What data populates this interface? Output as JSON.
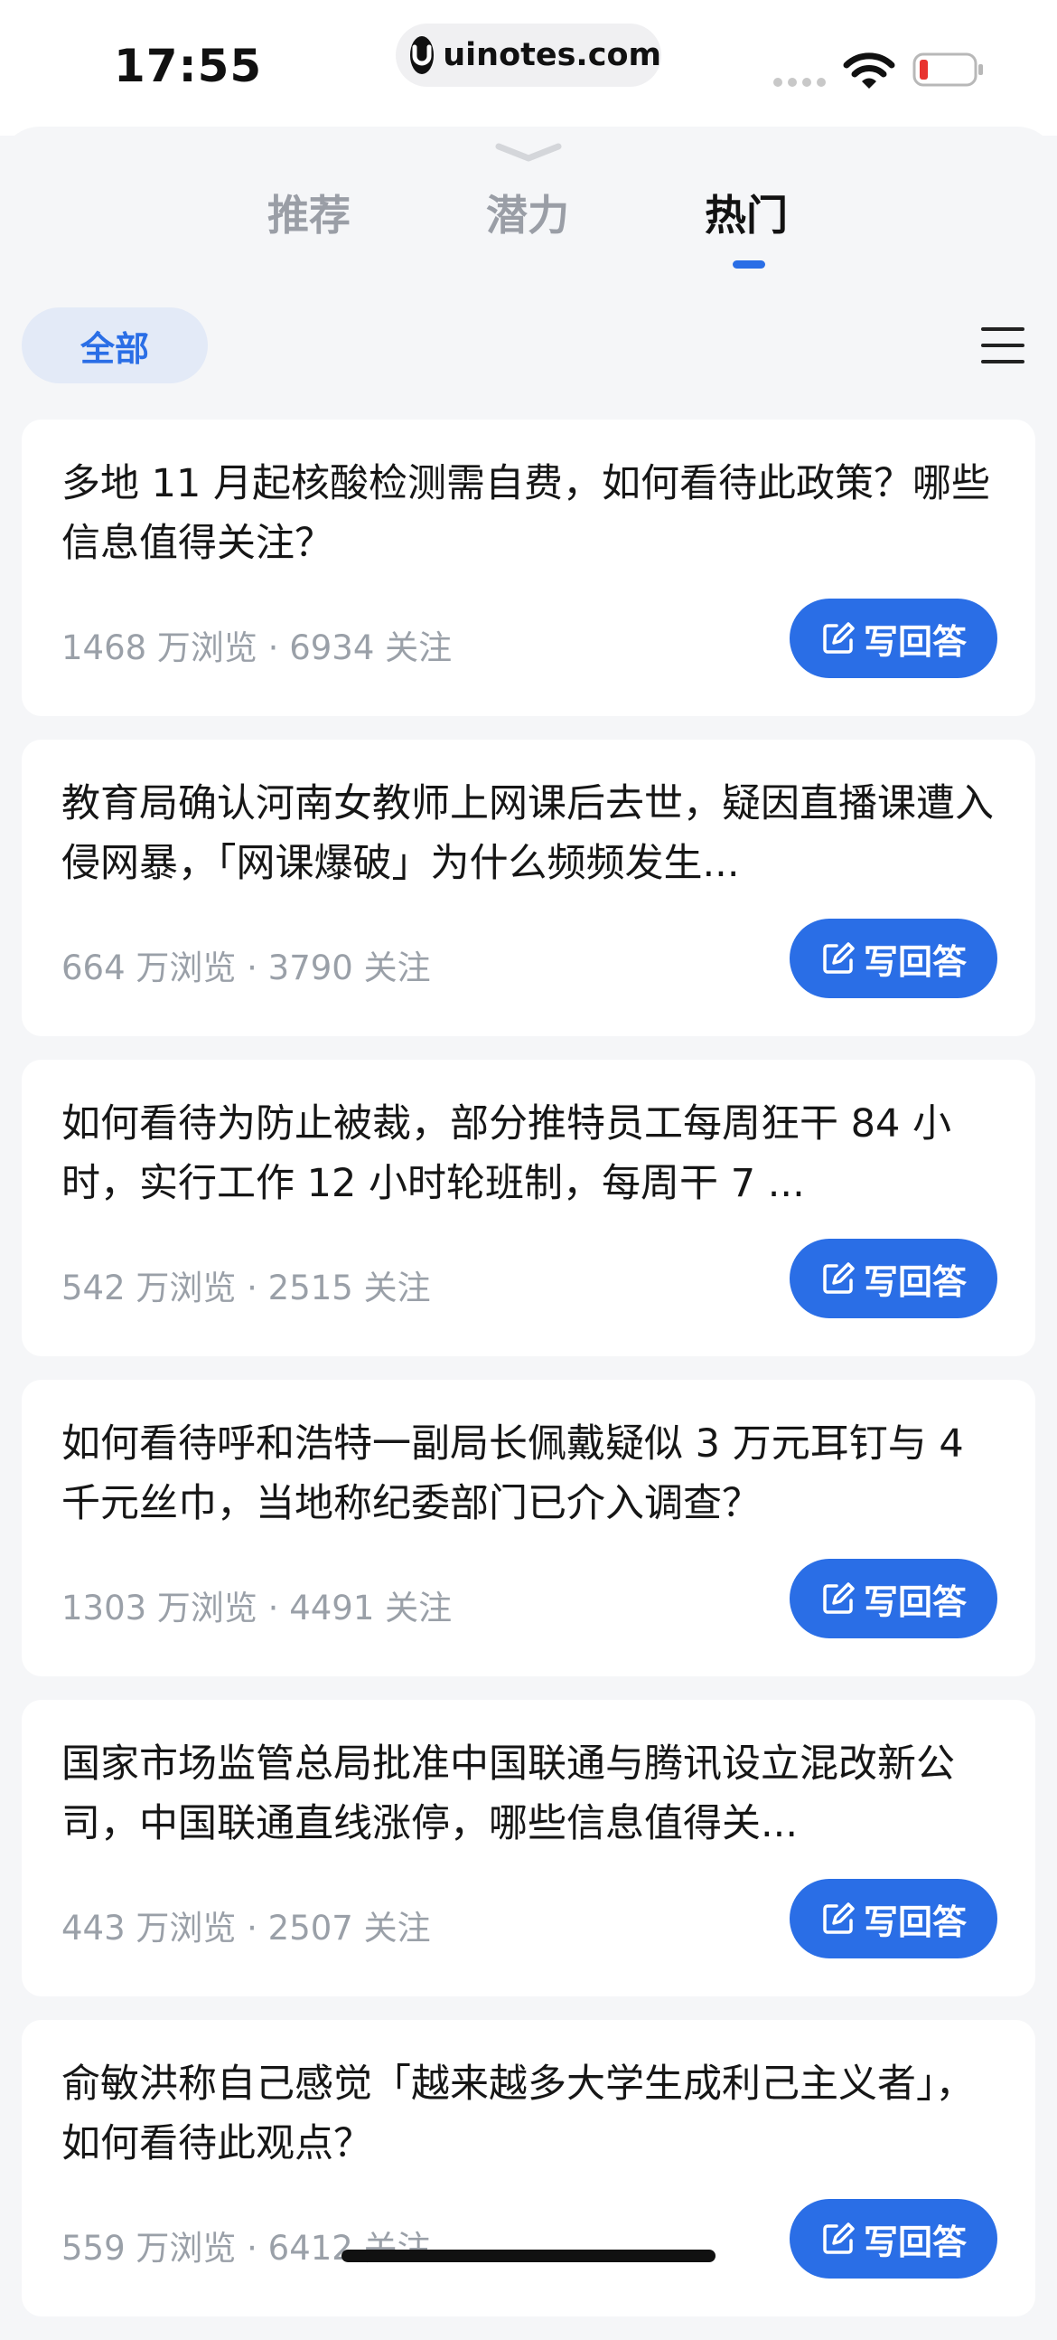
{
  "status_bar": {
    "time": "17:55",
    "url": "uinotes.com"
  },
  "tabs": [
    {
      "label": "推荐",
      "active": false
    },
    {
      "label": "潜力",
      "active": false
    },
    {
      "label": "热门",
      "active": true
    }
  ],
  "filter": {
    "label": "全部"
  },
  "answer_label": "写回答",
  "cards": [
    {
      "title": "多地 11 月起核酸检测需自费，如何看待此政策？哪些信息值得关注？",
      "meta": "1468 万浏览 · 6934 关注"
    },
    {
      "title": "教育局确认河南女教师上网课后去世，疑因直播课遭入侵网暴，「网课爆破」为什么频频发生...",
      "meta": "664 万浏览 · 3790 关注"
    },
    {
      "title": "如何看待为防止被裁，部分推特员工每周狂干 84 小时，实行工作 12 小时轮班制，每周干 7 ...",
      "meta": "542 万浏览 · 2515 关注"
    },
    {
      "title": "如何看待呼和浩特一副局长佩戴疑似 3 万元耳钉与 4 千元丝巾，当地称纪委部门已介入调查？",
      "meta": "1303 万浏览 · 4491 关注"
    },
    {
      "title": "国家市场监管总局批准中国联通与腾讯设立混改新公司，中国联通直线涨停，哪些信息值得关...",
      "meta": "443 万浏览 · 2507 关注"
    },
    {
      "title": "俞敏洪称自己感觉「越来越多大学生成利己主义者」，如何看待此观点？",
      "meta": "559 万浏览 · 6412 关注"
    }
  ],
  "colors": {
    "accent": "#2a6ee6",
    "chip_bg": "#e3eaf7",
    "background": "#f5f6f8"
  }
}
